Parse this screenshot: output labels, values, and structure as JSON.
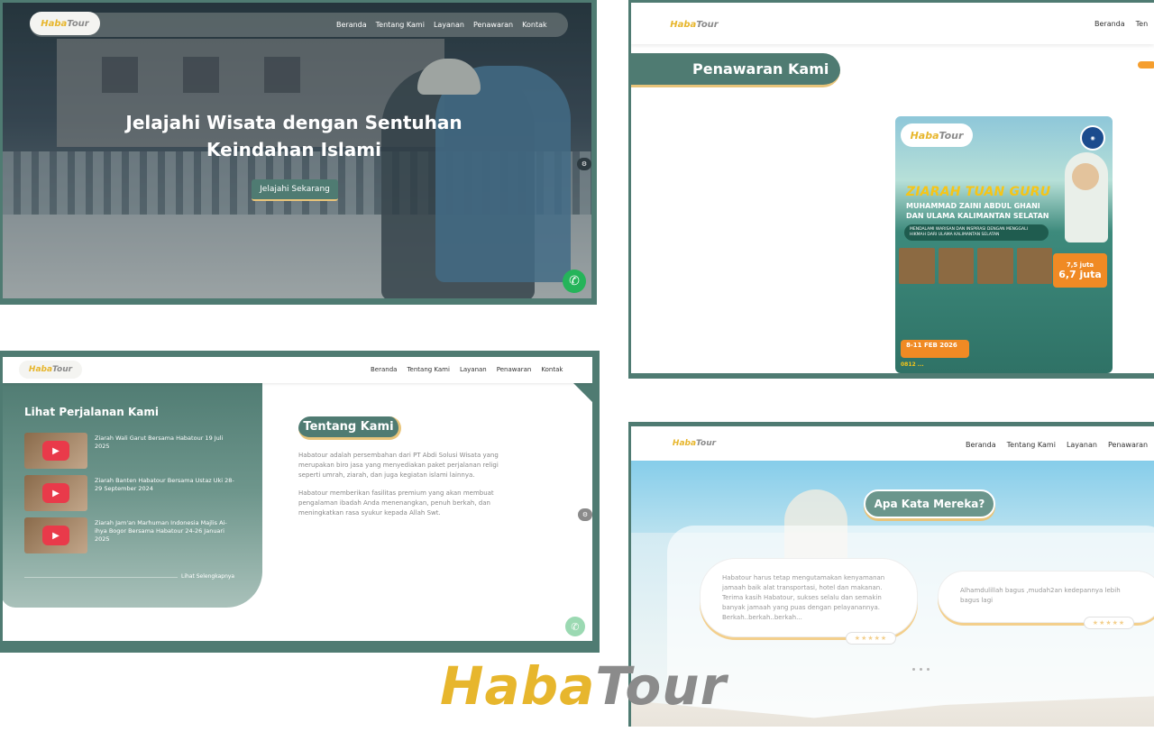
{
  "brand": {
    "haba": "Haba",
    "tour": "Tour"
  },
  "colors": {
    "primary": "#4f7b72",
    "accent": "#e7b62d",
    "gray": "#8a8a8a",
    "whatsapp": "#25b45a"
  },
  "hero": {
    "nav": [
      "Beranda",
      "Tentang Kami",
      "Layanan",
      "Penawaran",
      "Kontak"
    ],
    "title_line1": "Jelajahi Wisata dengan Sentuhan",
    "title_line2": "Keindahan Islami",
    "cta": "Jelajahi Sekarang",
    "whatsapp_icon": "whatsapp-icon"
  },
  "offers": {
    "nav": [
      "Beranda",
      "Ten"
    ],
    "title": "Penawaran Kami",
    "poster": {
      "title": "ZIARAH TUAN GURU",
      "subtitle_line1": "MUHAMMAD ZAINI ABDUL GHANI",
      "subtitle_line2": "DAN ULAMA KALIMANTAN SELATAN",
      "tagline": "MENDALAMI WARISAN DAN INSPIRASI DENGAN MENGGALI HIKMAH DARI ULAMA KALIMANTAN SELATAN",
      "price_a": "7,5 juta",
      "price_b": "6,7 juta",
      "date": "8-11 FEB 2026",
      "phone": "0812 ..."
    }
  },
  "about": {
    "nav": [
      "Beranda",
      "Tentang Kami",
      "Layanan",
      "Penawaran",
      "Kontak"
    ],
    "journeys_title": "Lihat Perjalanan Kami",
    "videos": [
      {
        "title": "Ziarah Wali Garut Bersama Habatour 19 Juli 2025"
      },
      {
        "title": "Ziarah Banten Habatour Bersama Ustaz Uki 28-29 September 2024"
      },
      {
        "title": "Ziarah Jam'an Marhuman Indonesia Majlis Ai-ihya Bogor Bersama Habatour 24-26 Januari 2025"
      }
    ],
    "more": "Lihat Selengkapnya",
    "title": "Tentang Kami",
    "p1": "Habatour adalah persembahan dari PT Abdi Solusi Wisata yang merupakan biro jasa yang menyediakan paket perjalanan religi seperti umrah, ziarah, dan juga kegiatan islami lainnya.",
    "p2": "Habatour memberikan fasilitas premium yang akan membuat pengalaman ibadah Anda menenangkan, penuh berkah, dan meningkatkan rasa syukur kepada Allah Swt."
  },
  "testimonials": {
    "nav": [
      "Beranda",
      "Tentang Kami",
      "Layanan",
      "Penawaran"
    ],
    "title": "Apa Kata Mereka?",
    "items": [
      {
        "text": "Habatour harus tetap mengutamakan kenyamanan jamaah baik alat transportasi, hotel dan makanan. Terima kasih Habatour, sukses selalu dan semakin banyak jamaah yang puas dengan pelayanannya. Berkah..berkah..berkah...",
        "rating": 5
      },
      {
        "text": "Alhamdulillah bagus ,mudah2an kedepannya lebih bagus lagi",
        "rating": 5
      }
    ]
  }
}
